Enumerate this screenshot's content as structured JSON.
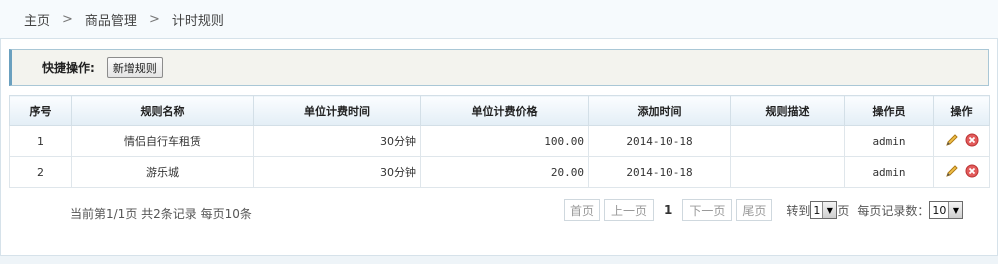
{
  "breadcrumb": {
    "items": [
      "主页",
      "商品管理",
      "计时规则"
    ],
    "separator": ">"
  },
  "quick_ops": {
    "label": "快捷操作:",
    "add_button": "新增规则"
  },
  "table": {
    "headers": [
      "序号",
      "规则名称",
      "单位计费时间",
      "单位计费价格",
      "添加时间",
      "规则描述",
      "操作员",
      "操作"
    ],
    "rows": [
      {
        "index": "1",
        "name": "情侣自行车租赁",
        "unit_time": "30分钟",
        "unit_price": "100.00",
        "added": "2014-10-18",
        "desc": "",
        "operator": "admin"
      },
      {
        "index": "2",
        "name": "游乐城",
        "unit_time": "30分钟",
        "unit_price": "20.00",
        "added": "2014-10-18",
        "desc": "",
        "operator": "admin"
      }
    ],
    "actions": {
      "edit_icon": "pencil-icon",
      "delete_icon": "close-circle-icon"
    }
  },
  "pager": {
    "summary": "当前第1/1页 共2条记录 每页10条",
    "first": "首页",
    "prev": "上一页",
    "current": "1",
    "next": "下一页",
    "last": "尾页",
    "goto_prefix": "转到",
    "goto_value": "1",
    "goto_suffix": "页",
    "per_page_label": "每页记录数：",
    "per_page_value": "10"
  },
  "colors": {
    "accent": "#6aa0bf",
    "delete": "#e25b5b",
    "edit": "#d99a2b"
  }
}
